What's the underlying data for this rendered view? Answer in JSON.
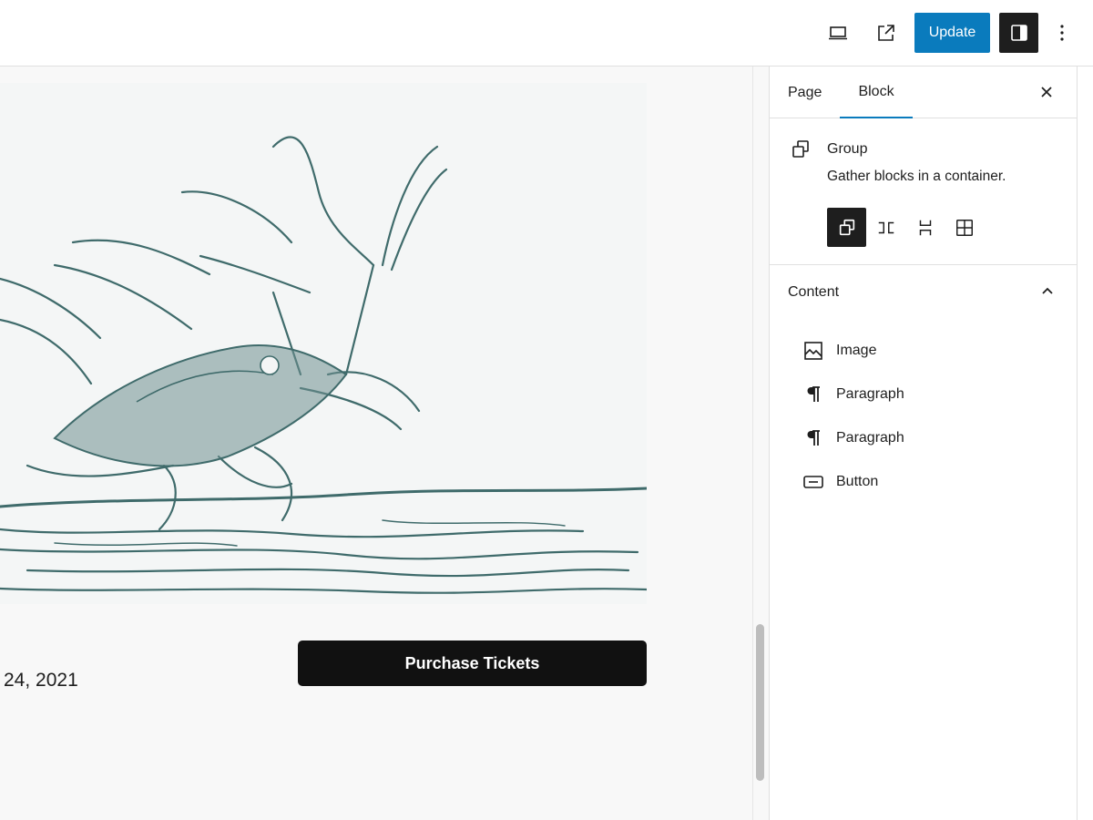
{
  "topbar": {
    "preview_icon": "laptop-icon",
    "view_icon": "external-link-icon",
    "update_label": "Update",
    "settings_icon": "sidebar-toggle-icon",
    "more_icon": "vertical-dots-icon",
    "accent": "#0a7bbd"
  },
  "canvas": {
    "button_label": "Purchase Tickets",
    "date_text": "24, 2021",
    "artwork_icon": "cranes-illustration"
  },
  "sidebar": {
    "tabs": [
      {
        "label": "Page"
      },
      {
        "label": "Block"
      }
    ],
    "close_icon": "close-icon",
    "block": {
      "title": "Group",
      "description": "Gather blocks in a container.",
      "variations": [
        {
          "icon": "group-icon"
        },
        {
          "icon": "row-icon"
        },
        {
          "icon": "stack-icon"
        },
        {
          "icon": "grid-icon"
        }
      ]
    },
    "content_panel": {
      "title": "Content",
      "items": [
        {
          "label": "Image",
          "icon": "image-icon"
        },
        {
          "label": "Paragraph",
          "icon": "paragraph-icon"
        },
        {
          "label": "Paragraph",
          "icon": "paragraph-icon"
        },
        {
          "label": "Button",
          "icon": "button-icon"
        }
      ]
    }
  }
}
